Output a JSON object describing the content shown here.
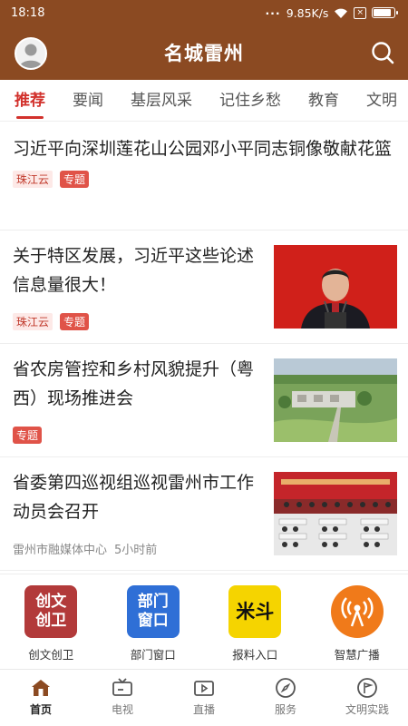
{
  "status_bar": {
    "time": "18:18",
    "network_speed": "9.85K/s",
    "battery_level": 0.9,
    "sim_label": "×"
  },
  "header": {
    "title": "名城雷州",
    "bg_color": "#8b4a22"
  },
  "tabs": [
    {
      "label": "推荐",
      "active": true
    },
    {
      "label": "要闻"
    },
    {
      "label": "基层风采"
    },
    {
      "label": "记住乡愁"
    },
    {
      "label": "教育"
    },
    {
      "label": "文明"
    }
  ],
  "news": [
    {
      "title": "习近平向深圳莲花山公园邓小平同志铜像敬献花篮",
      "source": "珠江云",
      "badge": "专题"
    },
    {
      "title": "关于特区发展，习近平这些论述信息量很大！",
      "source": "珠江云",
      "badge": "专题",
      "image": "speaker-at-podium"
    },
    {
      "title": "省农房管控和乡村风貌提升（粤西）现场推进会",
      "badge": "专题",
      "image": "rural-aerial-view"
    },
    {
      "title": "省委第四巡视组巡视雷州市工作动员会召开",
      "source": "雷州市融媒体中心",
      "time": "5小时前",
      "image": "meeting-hall"
    }
  ],
  "quick_entries": [
    {
      "label": "创文创卫",
      "icon_text_1": "创文",
      "icon_text_2": "创卫",
      "color": "#b23a3a"
    },
    {
      "label": "部门窗口",
      "icon_text_1": "部门",
      "icon_text_2": "窗口",
      "color": "#2f6fd6"
    },
    {
      "label": "报料入口",
      "icon_text_1": "米斗",
      "color": "#f5d400"
    },
    {
      "label": "智慧广播",
      "icon": "broadcast-icon",
      "color": "#f07a1a"
    }
  ],
  "bottom_nav": [
    {
      "label": "首页",
      "icon": "home-icon",
      "active": true
    },
    {
      "label": "电视",
      "icon": "tv-icon"
    },
    {
      "label": "直播",
      "icon": "live-icon"
    },
    {
      "label": "服务",
      "icon": "compass-icon"
    },
    {
      "label": "文明实践",
      "icon": "flag-icon"
    }
  ],
  "colors": {
    "accent": "#d2312c",
    "badge": "#e05348"
  }
}
